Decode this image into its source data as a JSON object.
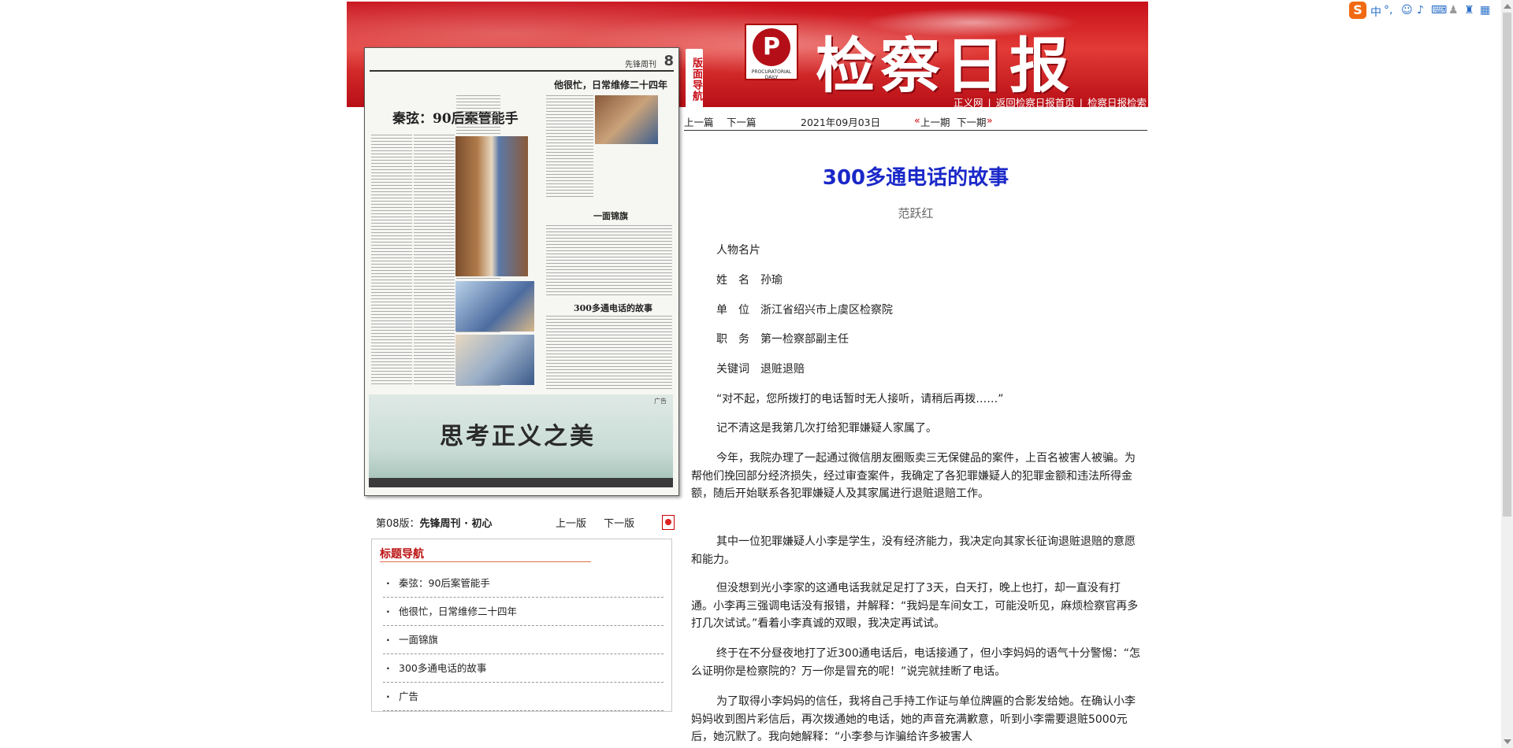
{
  "header": {
    "masthead": "检察日报",
    "side_nav_label": "版面导航",
    "logo_mark": "P",
    "logo_sub": "PROCURATORIAL DAILY",
    "links": [
      "正义网",
      "返回检察日报首页",
      "检察日报检索"
    ]
  },
  "paper": {
    "page_no": "8",
    "weekly": "先锋周刊",
    "headlines": [
      "秦弦：90后案管能手",
      "他很忙，日常维修二十四年",
      "一面锦旗",
      "300多通电话的故事"
    ],
    "ad_slogan": "思考正义之美",
    "ad_tag": "广告"
  },
  "page_info": {
    "label": "第08版：",
    "name": "先锋周刊 · 初心",
    "prev": "上一版",
    "next": "下一版"
  },
  "titlenav": {
    "caption": "标题导航",
    "items": [
      "秦弦：90后案管能手",
      "他很忙，日常维修二十四年",
      "一面锦旗",
      "300多通电话的故事",
      "广告"
    ]
  },
  "artnav": {
    "prev": "上一篇",
    "next": "下一篇",
    "date": "2021年09月03日",
    "prev_issue": "上一期",
    "next_issue": "下一期"
  },
  "article": {
    "title": "300多通电话的故事",
    "author": "范跃红",
    "paragraphs": [
      "人物名片",
      "姓　名　孙瑜",
      "单　位　浙江省绍兴市上虞区检察院",
      "职　务　第一检察部副主任",
      "关键词　退赃退赔",
      "“对不起，您所拨打的电话暂时无人接听，请稍后再拨……”",
      "记不清这是我第几次打给犯罪嫌疑人家属了。",
      "今年，我院办理了一起通过微信朋友圈贩卖三无保健品的案件，上百名被害人被骗。为帮他们挽回部分经济损失，经过审查案件，我确定了各犯罪嫌疑人的犯罪金额和违法所得金额，随后开始联系各犯罪嫌疑人及其家属进行退赃退赔工作。",
      "其中一位犯罪嫌疑人小李是学生，没有经济能力，我决定向其家长征询退赃退赔的意愿和能力。",
      "但没想到光小李家的这通电话我就足足打了3天，白天打，晚上也打，却一直没有打通。小李再三强调电话没有报错，并解释：“我妈是车间女工，可能没听见，麻烦检察官再多打几次试试。”看着小李真诚的双眼，我决定再试试。",
      "终于在不分昼夜地打了近300通电话后，电话接通了，但小李妈妈的语气十分警惕：“怎么证明你是检察院的？万一你是冒充的呢！”说完就挂断了电话。",
      "为了取得小李妈妈的信任，我将自己手持工作证与单位牌匾的合影发给她。在确认小李妈妈收到图片彩信后，再次拨通她的电话，她的声音充满歉意，听到小李需要退赃5000元后，她沉默了。我向她解释：“小李参与诈骗给许多被害人"
    ]
  },
  "ime": {
    "logo": "S",
    "mode": "中"
  }
}
